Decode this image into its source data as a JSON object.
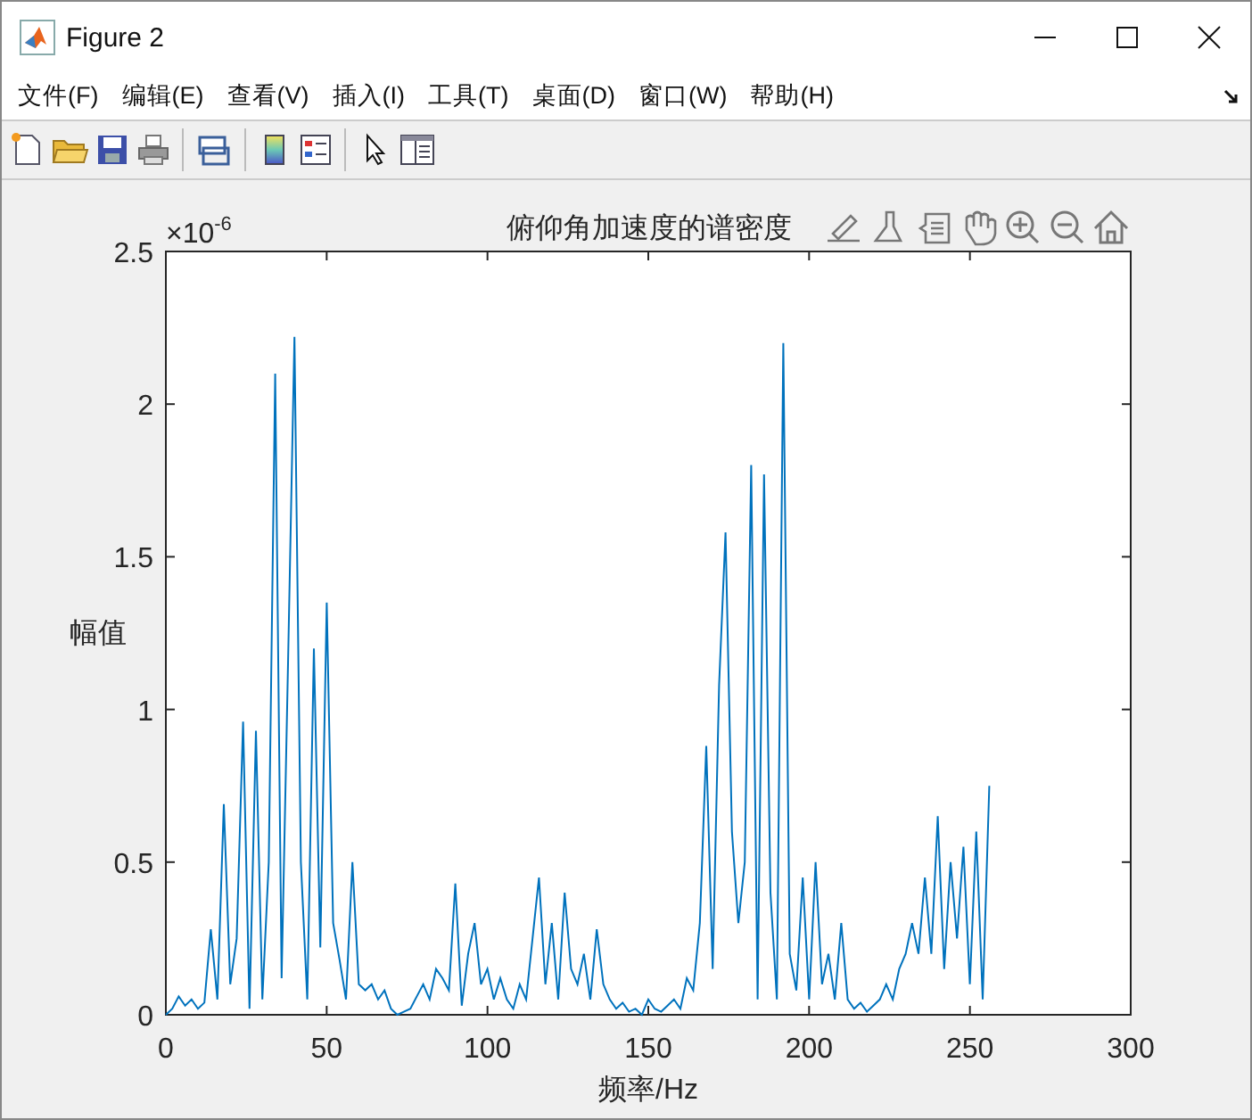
{
  "window": {
    "title": "Figure 2"
  },
  "menu": [
    "文件(F)",
    "编辑(E)",
    "查看(V)",
    "插入(I)",
    "工具(T)",
    "桌面(D)",
    "窗口(W)",
    "帮助(H)"
  ],
  "axes": {
    "exponent": {
      "base": "×10",
      "power": "-6"
    },
    "chart_data": {
      "type": "line",
      "title": "俯仰角加速度的谱密度",
      "xlabel": "频率/Hz",
      "ylabel": "幅值",
      "xlim": [
        0,
        300
      ],
      "ylim": [
        0,
        2.5
      ],
      "xticks": [
        0,
        50,
        100,
        150,
        200,
        250,
        300
      ],
      "yticks": [
        0,
        0.5,
        1,
        1.5,
        2,
        2.5
      ],
      "x": [
        0,
        2,
        4,
        6,
        8,
        10,
        12,
        14,
        16,
        18,
        20,
        22,
        24,
        26,
        28,
        30,
        32,
        34,
        36,
        38,
        40,
        42,
        44,
        46,
        48,
        50,
        52,
        54,
        56,
        58,
        60,
        62,
        64,
        66,
        68,
        70,
        72,
        74,
        76,
        78,
        80,
        82,
        84,
        86,
        88,
        90,
        92,
        94,
        96,
        98,
        100,
        102,
        104,
        106,
        108,
        110,
        112,
        114,
        116,
        118,
        120,
        122,
        124,
        126,
        128,
        130,
        132,
        134,
        136,
        138,
        140,
        142,
        144,
        146,
        148,
        150,
        152,
        154,
        156,
        158,
        160,
        162,
        164,
        166,
        168,
        170,
        172,
        174,
        176,
        178,
        180,
        182,
        184,
        186,
        188,
        190,
        192,
        194,
        196,
        198,
        200,
        202,
        204,
        206,
        208,
        210,
        212,
        214,
        216,
        218,
        220,
        222,
        224,
        226,
        228,
        230,
        232,
        234,
        236,
        238,
        240,
        242,
        244,
        246,
        248,
        250,
        252,
        254,
        256
      ],
      "series": [
        {
          "color": "#0072bd",
          "values": [
            0,
            0.02,
            0.06,
            0.03,
            0.05,
            0.02,
            0.04,
            0.28,
            0.05,
            0.69,
            0.1,
            0.25,
            0.96,
            0.02,
            0.93,
            0.05,
            0.5,
            2.1,
            0.12,
            1.15,
            2.22,
            0.5,
            0.05,
            1.2,
            0.22,
            1.35,
            0.3,
            0.18,
            0.05,
            0.5,
            0.1,
            0.08,
            0.1,
            0.05,
            0.08,
            0.02,
            0,
            0.01,
            0.02,
            0.06,
            0.1,
            0.05,
            0.15,
            0.12,
            0.08,
            0.43,
            0.03,
            0.2,
            0.3,
            0.1,
            0.15,
            0.05,
            0.12,
            0.05,
            0.02,
            0.1,
            0.05,
            0.25,
            0.45,
            0.1,
            0.3,
            0.05,
            0.4,
            0.15,
            0.1,
            0.2,
            0.05,
            0.28,
            0.1,
            0.05,
            0.02,
            0.04,
            0.01,
            0.02,
            0,
            0.05,
            0.02,
            0.01,
            0.03,
            0.05,
            0.02,
            0.12,
            0.08,
            0.3,
            0.88,
            0.15,
            1.08,
            1.58,
            0.6,
            0.3,
            0.5,
            1.8,
            0.05,
            1.77,
            0.4,
            0.05,
            2.2,
            0.2,
            0.08,
            0.45,
            0.05,
            0.5,
            0.1,
            0.2,
            0.05,
            0.3,
            0.05,
            0.02,
            0.04,
            0.01,
            0.03,
            0.05,
            0.1,
            0.05,
            0.15,
            0.2,
            0.3,
            0.2,
            0.45,
            0.2,
            0.65,
            0.15,
            0.5,
            0.25,
            0.55,
            0.1,
            0.6,
            0.05,
            0.75
          ]
        }
      ]
    }
  }
}
